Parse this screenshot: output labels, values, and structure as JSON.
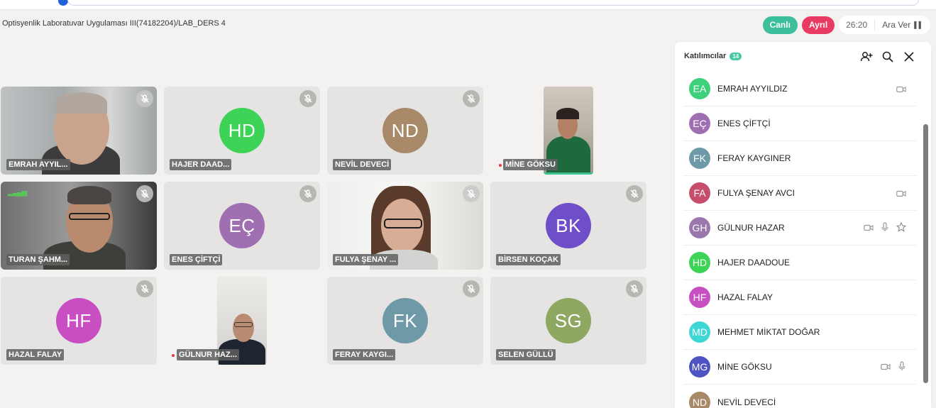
{
  "meeting": {
    "title": "Optisyenlik Laboratuvar Uygulaması III(74182204)/LAB_DERS 4",
    "live_label": "Canlı",
    "separate_label": "Ayrıl",
    "timer": "26:20",
    "break_label": "Ara Ver"
  },
  "tiles": [
    {
      "label": "EMRAH AYYIL...",
      "type": "video"
    },
    {
      "label": "HAJER DAAD...",
      "initials": "HD",
      "color": "#3cd357"
    },
    {
      "label": "NEVİL DEVECİ",
      "initials": "ND",
      "color": "#a88a69"
    },
    {
      "label": "MİNE GÖKSU",
      "type": "video"
    },
    {
      "label": "TURAN ŞAHM...",
      "type": "video"
    },
    {
      "label": "ENES ÇİFTÇİ",
      "initials": "EÇ",
      "color": "#9f6fb1"
    },
    {
      "label": "FULYA ŞENAY ...",
      "type": "video"
    },
    {
      "label": "BİRSEN KOÇAK",
      "initials": "BK",
      "color": "#6e4fc9"
    },
    {
      "label": "HAZAL FALAY",
      "initials": "HF",
      "color": "#c84fc1"
    },
    {
      "label": "GÜLNUR HAZ...",
      "type": "video"
    },
    {
      "label": "FERAY KAYGI...",
      "initials": "FK",
      "color": "#6e9aa8"
    },
    {
      "label": "SELEN GÜLLÜ",
      "initials": "SG",
      "color": "#8ea862"
    }
  ],
  "panel": {
    "title": "Katılımcılar",
    "count": "14",
    "participants": [
      {
        "initials": "EA",
        "name": "EMRAH AYYILDIZ",
        "color": "#3dd17b"
      },
      {
        "initials": "EÇ",
        "name": "ENES ÇİFTÇİ",
        "color": "#9f6fb1"
      },
      {
        "initials": "FK",
        "name": "FERAY KAYGINER",
        "color": "#6e9aa8"
      },
      {
        "initials": "FA",
        "name": "FULYA ŞENAY AVCI",
        "color": "#c64d6c"
      },
      {
        "initials": "GH",
        "name": "GÜLNUR HAZAR",
        "color": "#9a78ad"
      },
      {
        "initials": "HD",
        "name": "HAJER DAADOUE",
        "color": "#3cd357"
      },
      {
        "initials": "HF",
        "name": "HAZAL FALAY",
        "color": "#c84fc1"
      },
      {
        "initials": "MD",
        "name": "MEHMET MİKTAT DOĞAR",
        "color": "#3fd6d6"
      },
      {
        "initials": "MG",
        "name": "MİNE GÖKSU",
        "color": "#4d53c0"
      },
      {
        "initials": "ND",
        "name": "NEVİL DEVECİ",
        "color": "#a88a69"
      }
    ]
  }
}
